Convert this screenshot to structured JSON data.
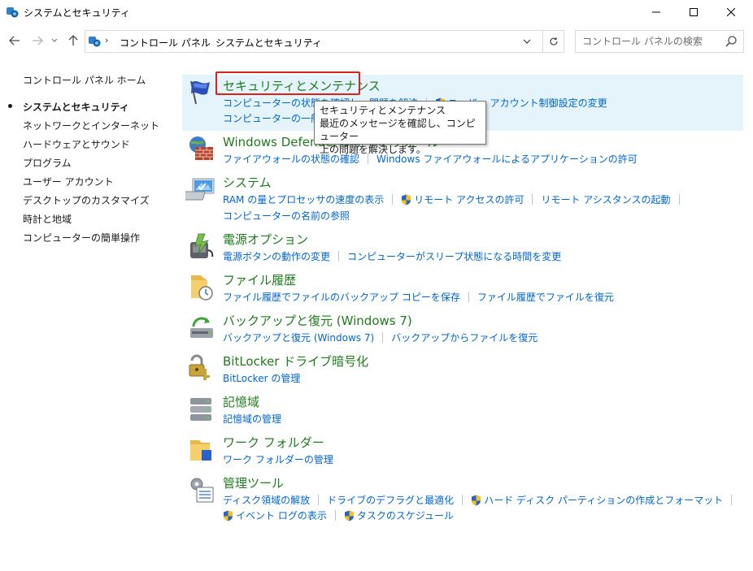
{
  "window": {
    "title": "システムとセキュリティ"
  },
  "address": {
    "crumbs": [
      "コントロール パネル",
      "システムとセキュリティ"
    ]
  },
  "search": {
    "placeholder": "コントロール パネルの検索"
  },
  "leftnav": {
    "home": "コントロール パネル ホーム",
    "items": [
      {
        "label": "システムとセキュリティ",
        "current": true
      },
      {
        "label": "ネットワークとインターネット"
      },
      {
        "label": "ハードウェアとサウンド"
      },
      {
        "label": "プログラム"
      },
      {
        "label": "ユーザー アカウント"
      },
      {
        "label": "デスクトップのカスタマイズ"
      },
      {
        "label": "時計と地域"
      },
      {
        "label": "コンピューターの簡単操作"
      }
    ]
  },
  "categories": [
    {
      "title": "セキュリティとメンテナンス",
      "icon": "flag-icon",
      "lines": [
        [
          "コンピューターの状態を確認し、問題を解決",
          "ユーザー アカウント制御設定の変更"
        ],
        [
          "コンピューターの一般的な問題のトラブルシューティング"
        ]
      ]
    },
    {
      "title": "Windows Defender ファイアウォール",
      "icon": "firewall-icon",
      "lines": [
        [
          "ファイアウォールの状態の確認",
          "Windows ファイアウォールによるアプリケーションの許可"
        ]
      ]
    },
    {
      "title": "システム",
      "icon": "system-icon",
      "lines": [
        [
          "RAM の量とプロセッサの速度の表示",
          "リモート アクセスの許可",
          "リモート アシスタンスの起動"
        ],
        [
          "コンピューターの名前の参照"
        ]
      ]
    },
    {
      "title": "電源オプション",
      "icon": "power-icon",
      "lines": [
        [
          "電源ボタンの動作の変更",
          "コンピューターがスリープ状態になる時間を変更"
        ]
      ]
    },
    {
      "title": "ファイル履歴",
      "icon": "file-history-icon",
      "lines": [
        [
          "ファイル履歴でファイルのバックアップ コピーを保存",
          "ファイル履歴でファイルを復元"
        ]
      ]
    },
    {
      "title": "バックアップと復元 (Windows 7)",
      "icon": "backup-icon",
      "lines": [
        [
          "バックアップと復元 (Windows 7)",
          "バックアップからファイルを復元"
        ]
      ]
    },
    {
      "title": "BitLocker ドライブ暗号化",
      "icon": "bitlocker-icon",
      "lines": [
        [
          "BitLocker の管理"
        ]
      ]
    },
    {
      "title": "記憶域",
      "icon": "storage-icon",
      "lines": [
        [
          "記憶域の管理"
        ]
      ]
    },
    {
      "title": "ワーク フォルダー",
      "icon": "work-folders-icon",
      "lines": [
        [
          "ワーク フォルダーの管理"
        ]
      ]
    },
    {
      "title": "管理ツール",
      "icon": "admin-tools-icon",
      "lines": [
        [
          "ディスク領域の解放",
          "ドライブのデフラグと最適化",
          "ハード ディスク パーティションの作成とフォーマット"
        ],
        [
          "イベント ログの表示",
          "タスクのスケジュール"
        ]
      ]
    }
  ],
  "tooltip": {
    "title": "セキュリティとメンテナンス",
    "line1": "最近のメッセージを確認し、コンピューター",
    "line2": "上の問題を解決します。"
  },
  "colors": {
    "category_title": "#1e7b1e",
    "link": "#0066cc",
    "highlight_bg": "#e5f3fb",
    "focus_box": "#e0201a"
  }
}
